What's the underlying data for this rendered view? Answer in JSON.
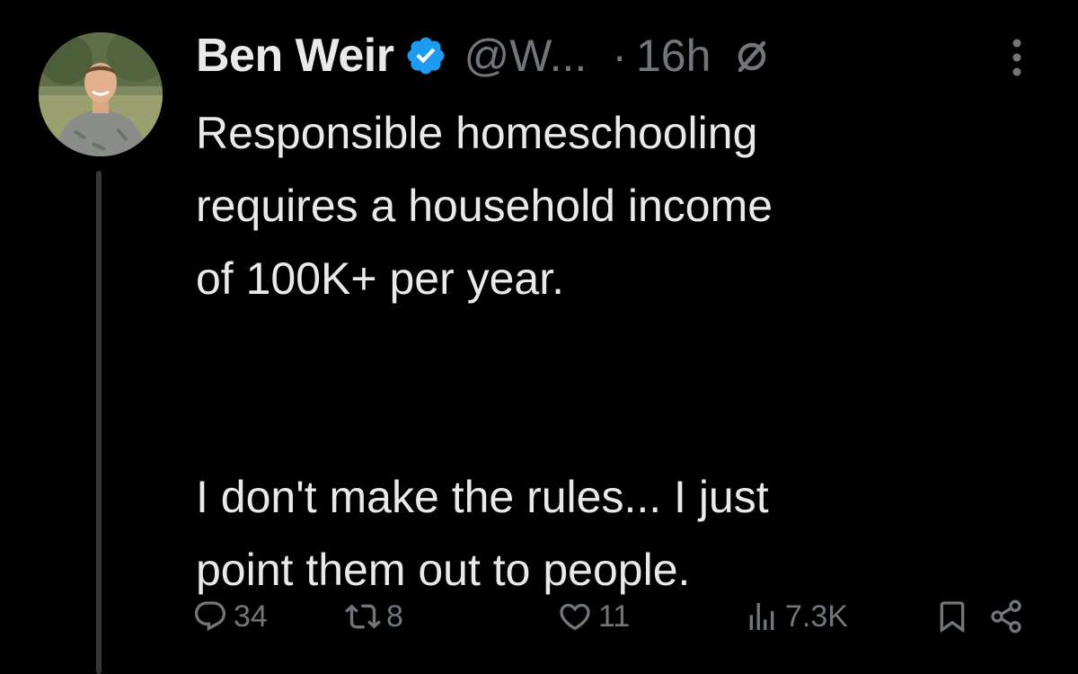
{
  "author": {
    "display_name": "Ben Weir",
    "handle": "@W...",
    "verified_color": "#1d9bf0"
  },
  "meta": {
    "separator": "·",
    "time": "16h"
  },
  "tweet": {
    "paragraphs": [
      [
        "Responsible homeschooling",
        "requires a household income",
        "of 100K+ per year."
      ],
      [
        "I don't make the rules... I just",
        "point them out to people."
      ]
    ]
  },
  "actions": {
    "reply_count": "34",
    "retweet_count": "8",
    "like_count": "11",
    "views_count": "7.3K"
  },
  "icons": {
    "verified": "verified-badge-icon",
    "edited": "circle-slash-icon",
    "more": "more-vertical-icon",
    "reply": "speech-bubble-icon",
    "retweet": "retweet-icon",
    "like": "heart-icon",
    "views": "bar-chart-icon",
    "bookmark": "bookmark-icon",
    "share": "share-icon"
  },
  "colors": {
    "background": "#000000",
    "text": "#e7e9ea",
    "muted": "#71767b",
    "thread_line": "#333639"
  }
}
